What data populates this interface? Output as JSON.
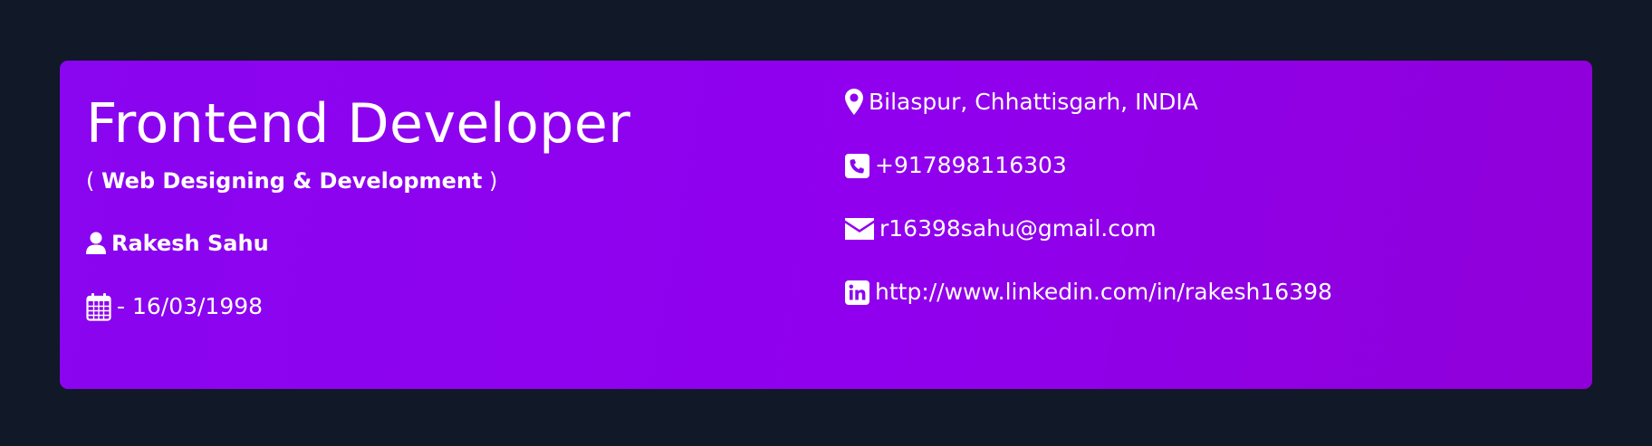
{
  "profile": {
    "title": "Frontend Developer",
    "subtitle_open": "( ",
    "subtitle_bold": "Web Designing & Development",
    "subtitle_close": " )",
    "name": "Rakesh Sahu",
    "dob": "- 16/03/1998"
  },
  "contact": {
    "location": "Bilaspur, Chhattisgarh, INDIA",
    "phone": "+917898116303",
    "email": "r16398sahu@gmail.com",
    "linkedin": "http://www.linkedin.com/in/rakesh16398"
  },
  "icons": {
    "name": "user-icon",
    "dob": "calendar-icon",
    "location": "map-marker-icon",
    "phone": "phone-square-icon",
    "email": "envelope-icon",
    "linkedin": "linkedin-icon"
  },
  "colors": {
    "page_background": "#111827",
    "card_gradient_start": "#8a05f0",
    "card_gradient_end": "#8f00d9",
    "text": "#ffffff"
  }
}
